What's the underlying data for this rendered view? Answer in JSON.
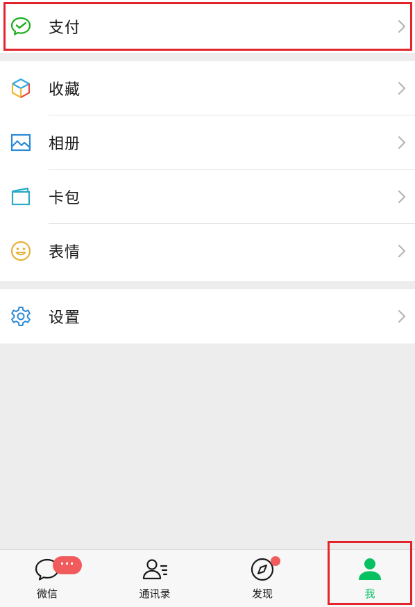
{
  "groups": {
    "pay": {
      "label": "支付",
      "icon": "wechat-pay-icon"
    },
    "favorites": {
      "label": "收藏",
      "icon": "favorites-cube-icon"
    },
    "album": {
      "label": "相册",
      "icon": "album-picture-icon"
    },
    "cards": {
      "label": "卡包",
      "icon": "card-wallet-icon"
    },
    "stickers": {
      "label": "表情",
      "icon": "sticker-smile-icon"
    },
    "settings": {
      "label": "设置",
      "icon": "gear-icon"
    }
  },
  "tabbar": {
    "chats": {
      "label": "微信",
      "badge": "···"
    },
    "contacts": {
      "label": "通讯录"
    },
    "discover": {
      "label": "发现"
    },
    "me": {
      "label": "我"
    }
  },
  "colors": {
    "accent_green": "#07c160",
    "highlight_red": "#e2252c",
    "badge_red": "#f15b5b",
    "background": "#ededed"
  }
}
